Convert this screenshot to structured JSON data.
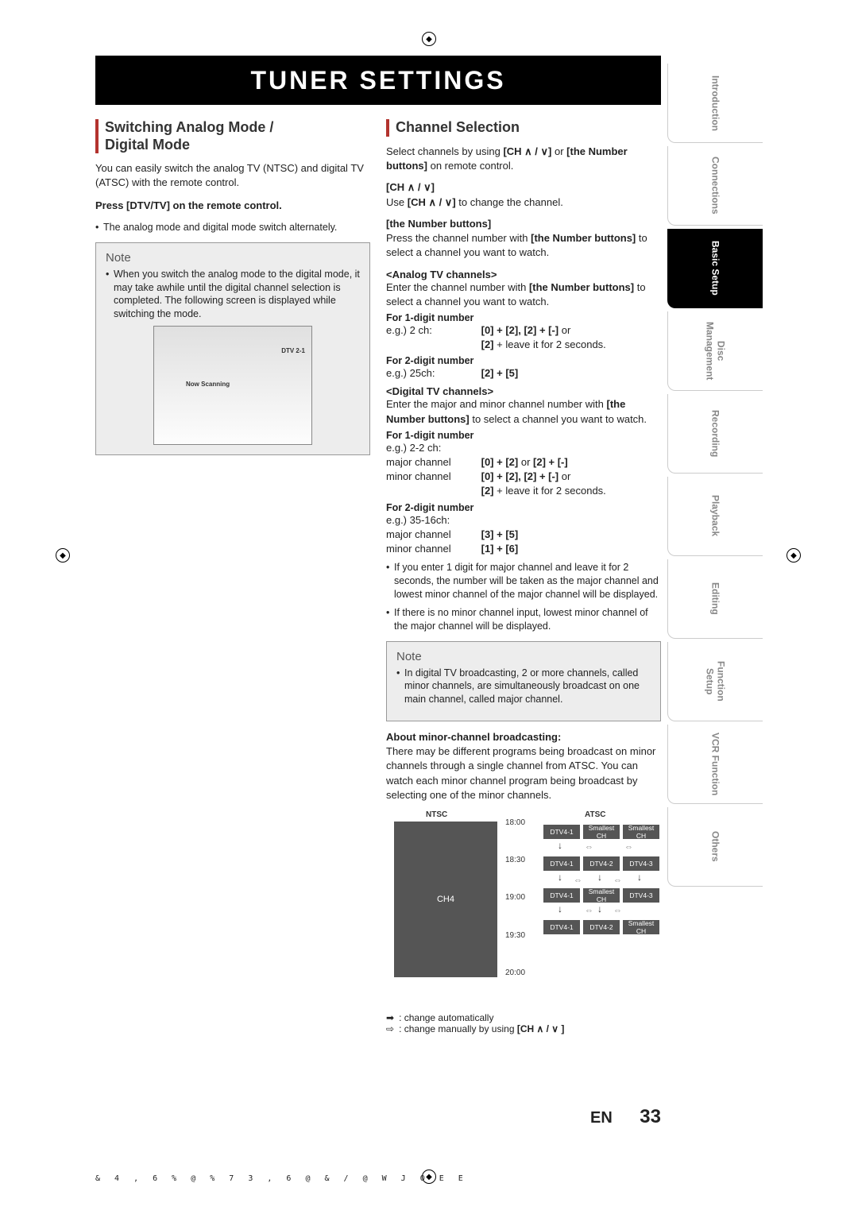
{
  "pageTitle": "TUNER SETTINGS",
  "footer": {
    "lang": "EN",
    "page": "33"
  },
  "tabs": [
    "Introduction",
    "Connections",
    "Basic Setup",
    "Disc Management",
    "Recording",
    "Playback",
    "Editing",
    "Function Setup",
    "VCR Function",
    "Others"
  ],
  "activeTab": "Basic Setup",
  "left": {
    "heading1": "Switching Analog Mode /",
    "heading2": "Digital Mode",
    "para1": "You can easily switch the analog TV (NTSC) and digital TV (ATSC) with the remote control.",
    "instr": "Press [DTV/TV] on the remote control.",
    "bullet1": "The analog mode and digital mode switch alternately.",
    "noteTitle": "Note",
    "noteBullet": "When you switch the analog mode to the digital mode, it may take awhile until the digital channel selection is completed. The following screen is displayed while switching the mode.",
    "screenDtv": "DTV 2-1",
    "screenScan": "Now Scanning"
  },
  "right": {
    "heading": "Channel Selection",
    "intro_a": "Select channels by using ",
    "intro_b": "[CH ∧ / ∨]",
    "intro_c": " or ",
    "intro_d": "[the Number buttons]",
    "intro_e": " on remote control.",
    "chHead": "[CH ∧ / ∨]",
    "chBody_a": "Use ",
    "chBody_b": "[CH ∧ / ∨]",
    "chBody_c": " to change the channel.",
    "numHead": "[the Number buttons]",
    "numBody_a": "Press the channel number with ",
    "numBody_b": "[the Number buttons]",
    "numBody_c": " to select a channel you want to watch.",
    "analogHead": "<Analog TV channels>",
    "analogBody_a": "Enter the channel number with ",
    "analogBody_b": "[the Number buttons]",
    "analogBody_c": " to select a channel you want to watch.",
    "for1": "For 1-digit number",
    "eg2ch": "e.g.) 2 ch:",
    "eg2ch_a": "[0] + [2], [2] + [-] ",
    "eg2ch_or": "or",
    "eg2ch_b": "[2]",
    "eg2ch_b_tail": " + leave it for 2 seconds.",
    "for2": "For 2-digit number",
    "eg25": "e.g.) 25ch:",
    "eg25_a": "[2] + [5]",
    "digitalHead": "<Digital TV channels>",
    "digitalBody_a": "Enter the major and minor channel number with ",
    "digitalBody_b": "[the Number buttons]",
    "digitalBody_c": " to select a channel you want to watch.",
    "d_for1": "For 1-digit number",
    "d_eg22": "e.g.) 2-2 ch:",
    "majorLabel": "major channel",
    "minorLabel": "minor channel",
    "d_major_a": "[0] + [2] ",
    "d_major_or": "or",
    "d_major_b": " [2] + [-]",
    "d_minor_a": "[0] + [2], [2] + [-] ",
    "d_minor_or": "or",
    "d_minor_b": "[2]",
    "d_minor_b_tail": " + leave it for 2 seconds.",
    "d_for2": "For 2-digit number",
    "d_eg35": "e.g.) 35-16ch:",
    "d2_major": "[3] + [5]",
    "d2_minor": "[1] + [6]",
    "bulletA": "If you enter 1 digit for major channel and leave it for 2 seconds, the number will be taken as the major channel and lowest minor channel of the major channel will be displayed.",
    "bulletB": "If there is no minor channel input, lowest minor channel of the major channel will be displayed.",
    "note2Title": "Note",
    "note2Bullet": "In digital TV broadcasting, 2 or more channels, called minor channels, are simultaneously broadcast on one main channel, called major channel.",
    "aboutHead": "About minor-channel broadcasting:",
    "aboutBody": "There may be different programs being broadcast on minor channels through a single channel from ATSC. You can watch each minor channel program being broadcast by selecting one of the minor channels.",
    "diagram": {
      "ntsc": "NTSC",
      "atsc": "ATSC",
      "ch4": "CH4",
      "times": [
        "18:00",
        "18:30",
        "19:00",
        "19:30",
        "20:00"
      ],
      "cells": {
        "r1c1": "DTV4-1",
        "r1c2": "Smallest CH",
        "r1c3": "Smallest CH",
        "r2c1": "DTV4-1",
        "r2c2": "DTV4-2",
        "r2c3": "DTV4-3",
        "r3c1": "DTV4-1",
        "r3c2": "Smallest CH",
        "r3c3": "DTV4-3",
        "r4c1": "DTV4-1",
        "r4c2": "DTV4-2",
        "r4c3": "Smallest CH"
      }
    },
    "legendAuto": " : change automatically",
    "legendManual_a": " : change manually by using ",
    "legendManual_b": "[CH ∧ / ∨ ]"
  },
  "printerLine": "& 4 , 6 % @ % 7 3   , 6 @ & / @ W   J O E E"
}
